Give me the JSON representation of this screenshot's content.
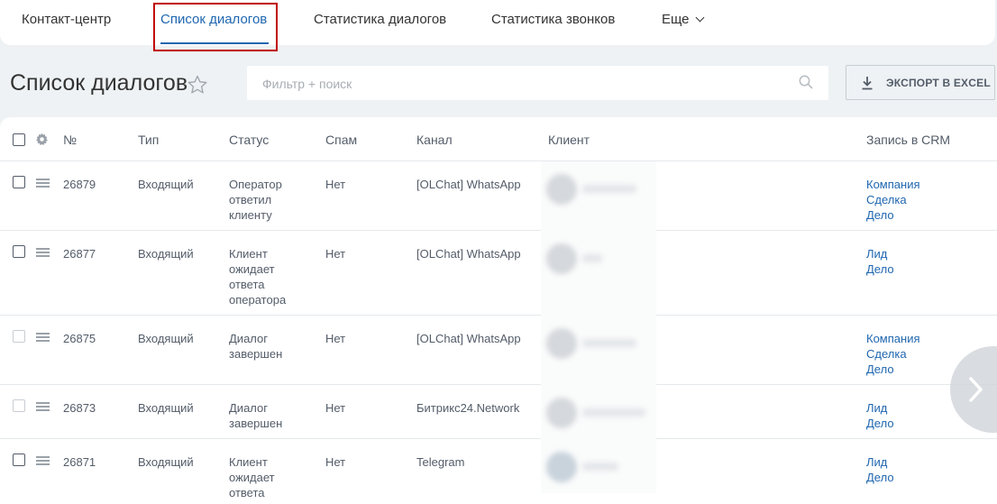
{
  "nav": {
    "items": [
      "Контакт-центр",
      "Список диалогов",
      "Статистика диалогов",
      "Статистика звонков"
    ],
    "more": "Еще"
  },
  "page": {
    "title": "Список диалогов",
    "filter_placeholder": "Фильтр + поиск",
    "export_label": "ЭКСПОРТ В EXCEL"
  },
  "columns": {
    "num": "№",
    "type": "Тип",
    "status": "Статус",
    "spam": "Спам",
    "channel": "Канал",
    "client": "Клиент",
    "crm": "Запись в CRM"
  },
  "rows": [
    {
      "id": "26879",
      "type": "Входящий",
      "status": [
        "Оператор",
        "ответил",
        "клиенту"
      ],
      "spam": "Нет",
      "channel": "[OLChat] WhatsApp",
      "crm": [
        "Компания",
        "Сделка",
        "Дело"
      ]
    },
    {
      "id": "26877",
      "type": "Входящий",
      "status": [
        "Клиент",
        "ожидает",
        "ответа",
        "оператора"
      ],
      "spam": "Нет",
      "channel": "[OLChat] WhatsApp",
      "crm": [
        "Лид",
        "Дело"
      ]
    },
    {
      "id": "26875",
      "type": "Входящий",
      "status": [
        "Диалог",
        "завершен"
      ],
      "spam": "Нет",
      "channel": "[OLChat] WhatsApp",
      "crm": [
        "Компания",
        "Сделка",
        "Дело"
      ]
    },
    {
      "id": "26873",
      "type": "Входящий",
      "status": [
        "Диалог",
        "завершен"
      ],
      "spam": "Нет",
      "channel": "Битрикс24.Network",
      "crm": [
        "Лид",
        "Дело"
      ]
    },
    {
      "id": "26871",
      "type": "Входящий",
      "status": [
        "Клиент",
        "ожидает",
        "ответа"
      ],
      "spam": "Нет",
      "channel": "Telegram",
      "crm": [
        "Лид",
        "Дело"
      ]
    }
  ]
}
